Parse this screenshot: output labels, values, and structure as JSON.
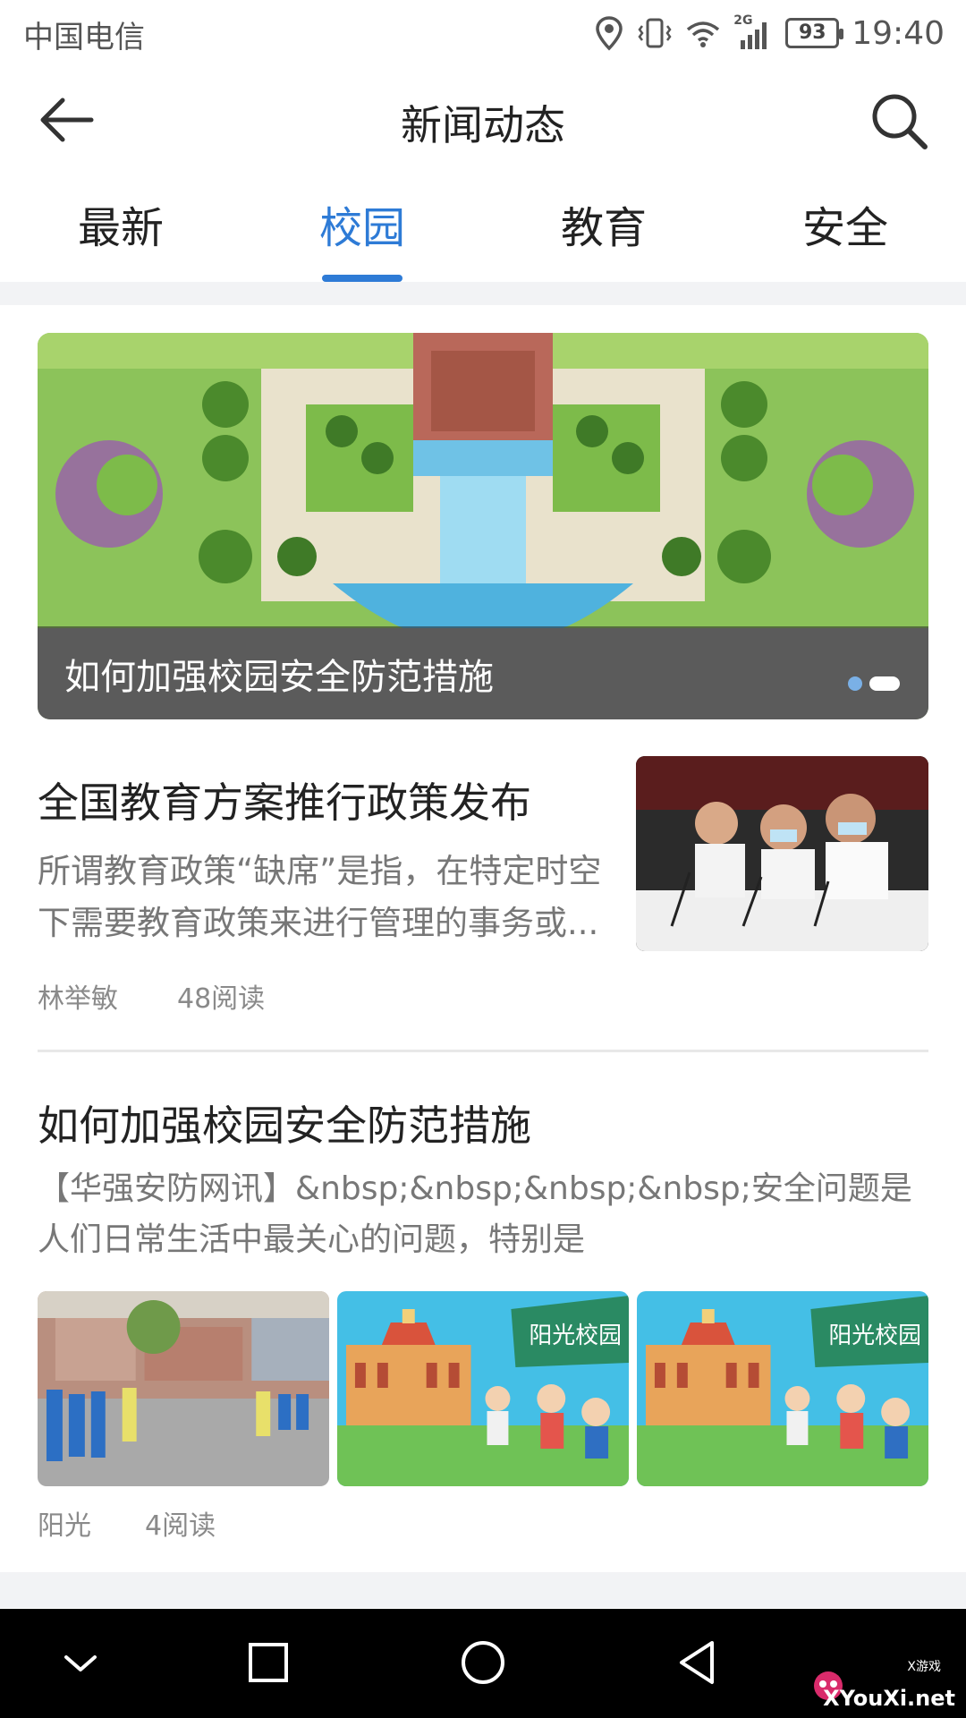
{
  "status_bar": {
    "carrier": "中国电信",
    "network": "2G",
    "battery": "93",
    "time": "19:40"
  },
  "header": {
    "title": "新闻动态",
    "back_icon": "back-arrow-icon",
    "search_icon": "search-icon"
  },
  "tabs": [
    {
      "label": "最新",
      "active": false
    },
    {
      "label": "校园",
      "active": true
    },
    {
      "label": "教育",
      "active": false
    },
    {
      "label": "安全",
      "active": false
    }
  ],
  "banner": {
    "caption": "如何加强校园安全防范措施",
    "slides": 2,
    "active_slide": 2
  },
  "articles": [
    {
      "title": "全国教育方案推行政策发布",
      "summary": "所谓教育政策“缺席”是指，在特定时空下需要教育政策来进行管理的事务或...",
      "author": "林举敏",
      "reads": "48阅读"
    },
    {
      "title": "如何加强校园安全防范措施",
      "summary": "【华强安防网讯】&nbsp;&nbsp;&nbsp;&nbsp;安全问题是人们日常生活中最关心的问题，特别是",
      "author": "阳光",
      "reads": "4阅读",
      "image_labels": [
        "阳光校园",
        "阳光校园"
      ]
    }
  ],
  "watermark": {
    "site": "XYouXi.net",
    "small": "X游戏"
  },
  "colors": {
    "accent": "#2e7bd6",
    "text": "#222222",
    "muted": "#777777"
  }
}
